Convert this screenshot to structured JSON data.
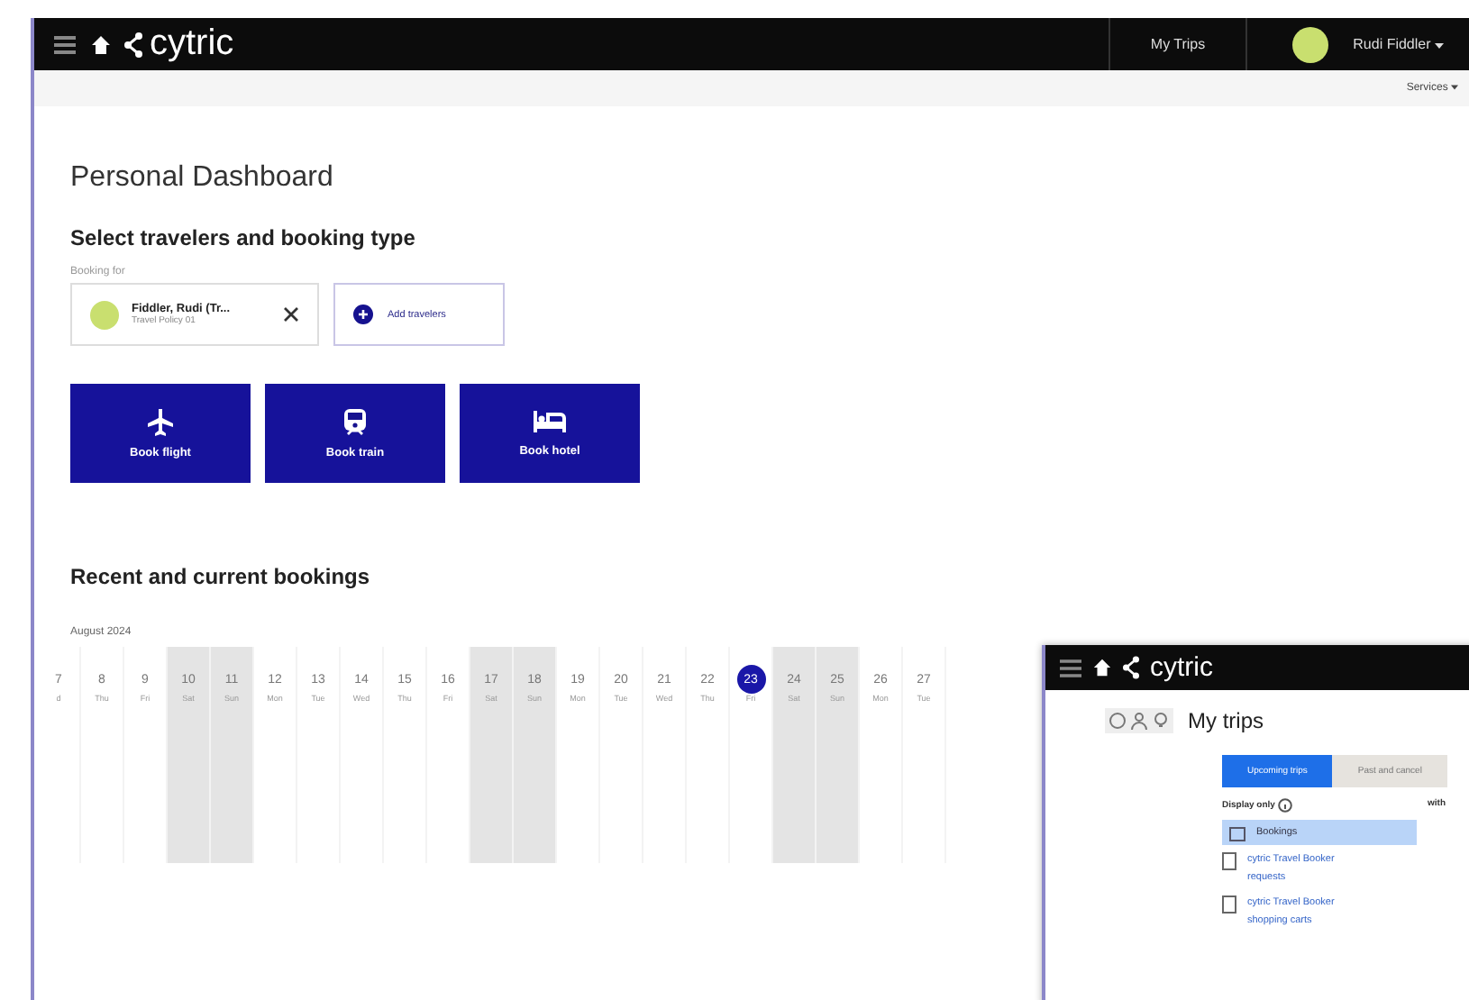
{
  "topbar": {
    "logo": "cytric",
    "nav": "My Trips",
    "user": "Rudi Fiddler"
  },
  "subbar": {
    "menu": "Services"
  },
  "page_title": "Personal Dashboard",
  "select_heading": "Select travelers and booking type",
  "booking_for_label": "Booking for",
  "traveler": {
    "name": "Fiddler, Rudi (Tr...",
    "detail": "Travel Policy 01"
  },
  "add_travelers": "Add travelers",
  "book_buttons": [
    {
      "kind": "flight",
      "label": "Book flight"
    },
    {
      "kind": "train",
      "label": "Book train"
    },
    {
      "kind": "hotel",
      "label": "Book hotel"
    }
  ],
  "recent_heading": "Recent and current bookings",
  "month": "August 2024",
  "days": [
    {
      "num": "7",
      "day": "d",
      "weekend": false,
      "selected": false
    },
    {
      "num": "8",
      "day": "Thu",
      "weekend": false,
      "selected": false
    },
    {
      "num": "9",
      "day": "Fri",
      "weekend": false,
      "selected": false
    },
    {
      "num": "10",
      "day": "Sat",
      "weekend": true,
      "selected": false
    },
    {
      "num": "11",
      "day": "Sun",
      "weekend": true,
      "selected": false
    },
    {
      "num": "12",
      "day": "Mon",
      "weekend": false,
      "selected": false
    },
    {
      "num": "13",
      "day": "Tue",
      "weekend": false,
      "selected": false
    },
    {
      "num": "14",
      "day": "Wed",
      "weekend": false,
      "selected": false
    },
    {
      "num": "15",
      "day": "Thu",
      "weekend": false,
      "selected": false
    },
    {
      "num": "16",
      "day": "Fri",
      "weekend": false,
      "selected": false
    },
    {
      "num": "17",
      "day": "Sat",
      "weekend": true,
      "selected": false
    },
    {
      "num": "18",
      "day": "Sun",
      "weekend": true,
      "selected": false
    },
    {
      "num": "19",
      "day": "Mon",
      "weekend": false,
      "selected": false
    },
    {
      "num": "20",
      "day": "Tue",
      "weekend": false,
      "selected": false
    },
    {
      "num": "21",
      "day": "Wed",
      "weekend": false,
      "selected": false
    },
    {
      "num": "22",
      "day": "Thu",
      "weekend": false,
      "selected": false
    },
    {
      "num": "23",
      "day": "Fri",
      "weekend": false,
      "selected": true
    },
    {
      "num": "24",
      "day": "Sat",
      "weekend": true,
      "selected": false
    },
    {
      "num": "25",
      "day": "Sun",
      "weekend": true,
      "selected": false
    },
    {
      "num": "26",
      "day": "Mon",
      "weekend": false,
      "selected": false
    },
    {
      "num": "27",
      "day": "Tue",
      "weekend": false,
      "selected": false
    }
  ],
  "trips_window": {
    "logo": "cytric",
    "title": "My trips",
    "tabs": [
      {
        "label": "Upcoming trips",
        "selected": true
      },
      {
        "label": "Past and cancel",
        "selected": false
      }
    ],
    "display_label": "Display only",
    "with_label": "with",
    "dropdown": "Bookings",
    "items": [
      "cytric Travel Booker requests",
      "cytric Travel Booker shopping carts"
    ]
  }
}
